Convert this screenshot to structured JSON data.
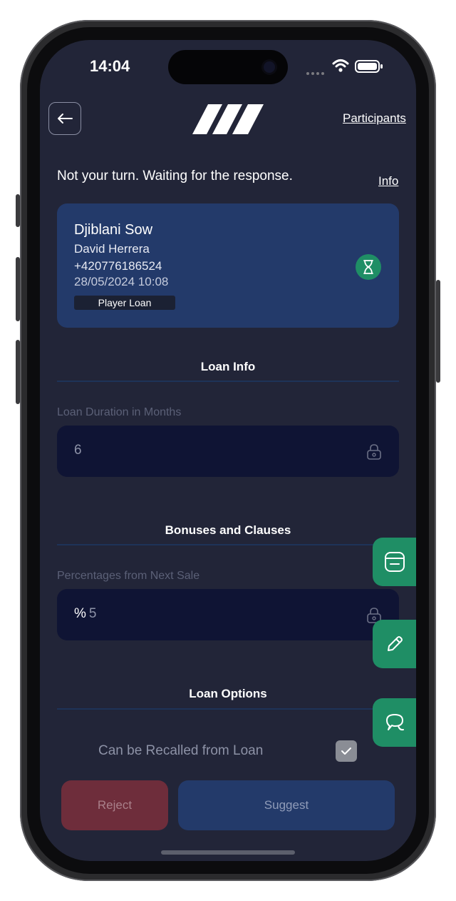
{
  "status_bar": {
    "time": "14:04"
  },
  "header": {
    "participants_link": "Participants"
  },
  "status": {
    "message": "Not your turn. Waiting for the response.",
    "info_link": "Info"
  },
  "player_card": {
    "player_name": "Djiblani Sow",
    "agent_name": "David Herrera",
    "phone": "+420776186524",
    "date": "28/05/2024 10:08",
    "badge": "Player Loan"
  },
  "loan_info": {
    "title": "Loan Info",
    "duration_label": "Loan Duration in Months",
    "duration_value": "6"
  },
  "bonuses": {
    "title": "Bonuses and Clauses",
    "percent_label": "Percentages from Next Sale",
    "percent_symbol": "%",
    "percent_value": "5"
  },
  "loan_options": {
    "title": "Loan Options",
    "recall_label": "Can be Recalled from Loan",
    "recall_checked": true
  },
  "actions": {
    "reject": "Reject",
    "suggest": "Suggest"
  },
  "colors": {
    "background": "#222538",
    "card": "#233a6a",
    "accent_green": "#1f8e65",
    "reject": "#6e2d3b",
    "field": "#0f1434"
  }
}
